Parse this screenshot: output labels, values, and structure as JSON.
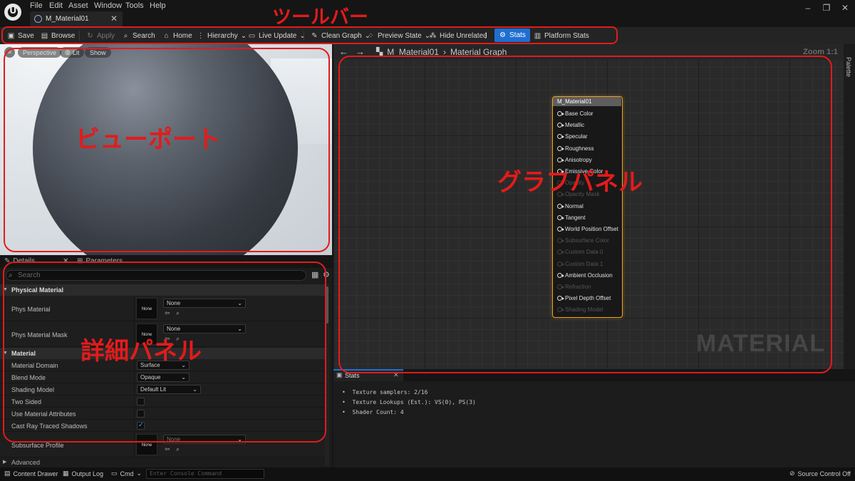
{
  "menu": {
    "items": [
      "File",
      "Edit",
      "Asset",
      "Window",
      "Tools",
      "Help"
    ]
  },
  "document_tab": {
    "title": "M_Material01"
  },
  "toolbar": {
    "save": "Save",
    "browse": "Browse",
    "apply": "Apply",
    "search": "Search",
    "home": "Home",
    "hierarchy": "Hierarchy",
    "live_update": "Live Update",
    "clean_graph": "Clean Graph",
    "preview_state": "Preview State",
    "hide_unrelated": "Hide Unrelated",
    "stats": "Stats",
    "platform_stats": "Platform Stats"
  },
  "viewport": {
    "perspective": "Perspective",
    "lit": "Lit",
    "show": "Show",
    "axis_z": "Z",
    "axis_x": "X"
  },
  "details": {
    "tab_details": "Details",
    "tab_parameters": "Parameters",
    "search_placeholder": "Search",
    "cat_physical": "Physical Material",
    "phys_material": {
      "label": "Phys Material",
      "value": "None",
      "thumb": "None"
    },
    "phys_material_mask": {
      "label": "Phys Material Mask",
      "value": "None",
      "thumb": "None"
    },
    "cat_material": "Material",
    "material_domain": {
      "label": "Material Domain",
      "value": "Surface"
    },
    "blend_mode": {
      "label": "Blend Mode",
      "value": "Opaque"
    },
    "shading_model": {
      "label": "Shading Model",
      "value": "Default Lit"
    },
    "two_sided": {
      "label": "Two Sided",
      "checked": false
    },
    "use_material_attributes": {
      "label": "Use Material Attributes",
      "checked": false
    },
    "cast_ray_traced_shadows": {
      "label": "Cast Ray Traced Shadows",
      "checked": true
    },
    "subsurface_profile": {
      "label": "Subsurface Profile",
      "value": "None",
      "thumb": "None"
    },
    "cat_advanced": "Advanced"
  },
  "graph": {
    "breadcrumb": [
      "M_Material01",
      "Material Graph"
    ],
    "zoom": "Zoom 1:1",
    "palette": "Palette",
    "watermark": "MATERIAL",
    "node": {
      "title": "M_Material01",
      "pins": [
        {
          "label": "Base Color",
          "enabled": true
        },
        {
          "label": "Metallic",
          "enabled": true
        },
        {
          "label": "Specular",
          "enabled": true
        },
        {
          "label": "Roughness",
          "enabled": true
        },
        {
          "label": "Anisotropy",
          "enabled": true
        },
        {
          "label": "Emissive Color",
          "enabled": true
        },
        {
          "label": "Opacity",
          "enabled": false
        },
        {
          "label": "Opacity Mask",
          "enabled": false
        },
        {
          "label": "Normal",
          "enabled": true
        },
        {
          "label": "Tangent",
          "enabled": true
        },
        {
          "label": "World Position Offset",
          "enabled": true
        },
        {
          "label": "Subsurface Color",
          "enabled": false
        },
        {
          "label": "Custom Data 0",
          "enabled": false
        },
        {
          "label": "Custom Data 1",
          "enabled": false
        },
        {
          "label": "Ambient Occlusion",
          "enabled": true
        },
        {
          "label": "Refraction",
          "enabled": false
        },
        {
          "label": "Pixel Depth Offset",
          "enabled": true
        },
        {
          "label": "Shading Model",
          "enabled": false
        }
      ]
    }
  },
  "stats": {
    "tab": "Stats",
    "lines": [
      "Texture samplers: 2/16",
      "Texture Lookups (Est.): VS(0), PS(3)",
      "Shader Count: 4"
    ]
  },
  "bottom": {
    "content_drawer": "Content Drawer",
    "output_log": "Output Log",
    "cmd": "Cmd",
    "console_placeholder": "Enter Console Command",
    "source_control": "Source Control Off"
  },
  "annotations": {
    "toolbar": "ツールバー",
    "viewport": "ビューポート",
    "details": "詳細パネル",
    "graph": "グラフパネル",
    "color": "#e31b1b"
  }
}
